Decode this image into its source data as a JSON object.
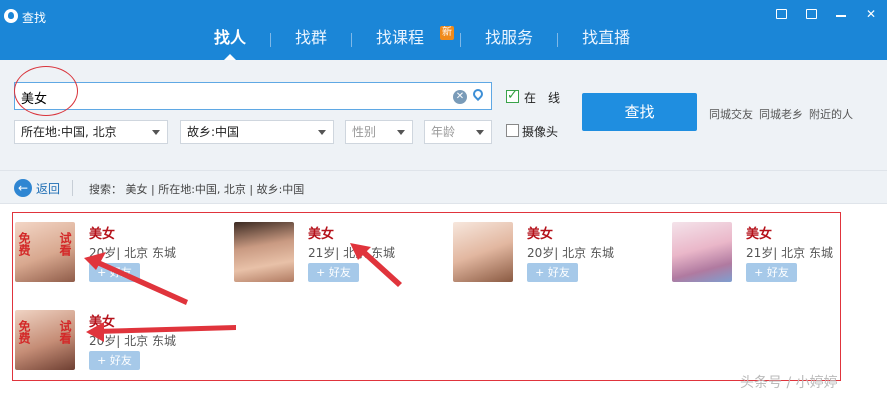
{
  "window": {
    "title": "查找"
  },
  "tabs": [
    {
      "label": "找人",
      "active": true
    },
    {
      "label": "找群",
      "active": false
    },
    {
      "label": "找课程",
      "active": false,
      "badge": "新"
    },
    {
      "label": "找服务",
      "active": false
    },
    {
      "label": "找直播",
      "active": false
    }
  ],
  "search": {
    "query": "美女",
    "location": "所在地:中国, 北京",
    "hometown": "故乡:中国",
    "gender_placeholder": "性别",
    "age_placeholder": "年龄",
    "online_label": "在　线",
    "online_checked": true,
    "camera_label": "摄像头",
    "camera_checked": false,
    "find_button": "查找",
    "quick_links": [
      "同城交友",
      "同城老乡",
      "附近的人"
    ]
  },
  "breadcrumb": {
    "back_label": "返回",
    "text": "搜索： 美女 | 所在地:中国, 北京 | 故乡:中国"
  },
  "results": [
    {
      "name": "美女",
      "meta": "20岁| 北京 东城",
      "add": "+ 好友",
      "tags": [
        "免费",
        "试看"
      ]
    },
    {
      "name": "美女",
      "meta": "21岁| 北京 东城",
      "add": "+ 好友",
      "tags": []
    },
    {
      "name": "美女",
      "meta": "20岁| 北京 东城",
      "add": "+ 好友",
      "tags": []
    },
    {
      "name": "美女",
      "meta": "21岁| 北京 东城",
      "add": "+ 好友",
      "tags": []
    },
    {
      "name": "美女",
      "meta": "20岁| 北京 东城",
      "add": "+ 好友",
      "tags": [
        "免费",
        "试看"
      ]
    }
  ],
  "watermark": "头条号 / 小婷婷",
  "colors": {
    "accent": "#1b86d7",
    "alert": "#e0343c"
  }
}
